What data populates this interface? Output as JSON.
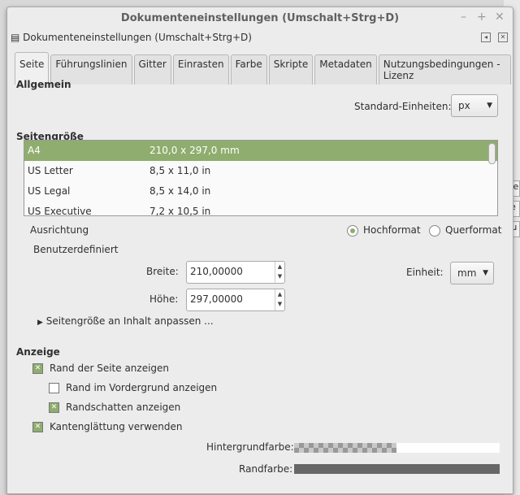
{
  "window": {
    "title": "Dokumenteneinstellungen (Umschalt+Strg+D)",
    "dock_title": "Dokumenteneinstellungen (Umschalt+Strg+D)"
  },
  "tabs": [
    "Seite",
    "Führungslinien",
    "Gitter",
    "Einrasten",
    "Farbe",
    "Skripte",
    "Metadaten",
    "Nutzungsbedingungen - Lizenz"
  ],
  "general": {
    "heading": "Allgemein",
    "units_label": "Standard-Einheiten:",
    "units_value": "px"
  },
  "pagesize": {
    "heading": "Seitengröße",
    "rows": [
      {
        "name": "A4",
        "size": "210,0 x 297,0 mm"
      },
      {
        "name": "US Letter",
        "size": "8,5 x 11,0 in"
      },
      {
        "name": "US Legal",
        "size": "8,5 x 14,0 in"
      },
      {
        "name": "US Executive",
        "size": "7,2 x 10,5 in"
      }
    ],
    "orientation_label": "Ausrichtung",
    "portrait": "Hochformat",
    "landscape": "Querformat",
    "custom_label": "Benutzerdefiniert",
    "width_label": "Breite:",
    "width_value": "210,00000",
    "height_label": "Höhe:",
    "height_value": "297,00000",
    "unit_label": "Einheit:",
    "unit_value": "mm",
    "fit_label": "Seitengröße an Inhalt anpassen ..."
  },
  "display": {
    "heading": "Anzeige",
    "show_border": "Rand der Seite anzeigen",
    "border_on_top": "Rand im Vordergrund anzeigen",
    "border_shadow": "Randschatten anzeigen",
    "antialias": "Kantenglättung verwenden",
    "bg_label": "Hintergrundfarbe:",
    "border_color_label": "Randfarbe:"
  },
  "background_fragments": [
    "ve",
    "ie",
    "tu"
  ],
  "colors": {
    "accent": "#8fad6e",
    "border_color": "#676767"
  }
}
